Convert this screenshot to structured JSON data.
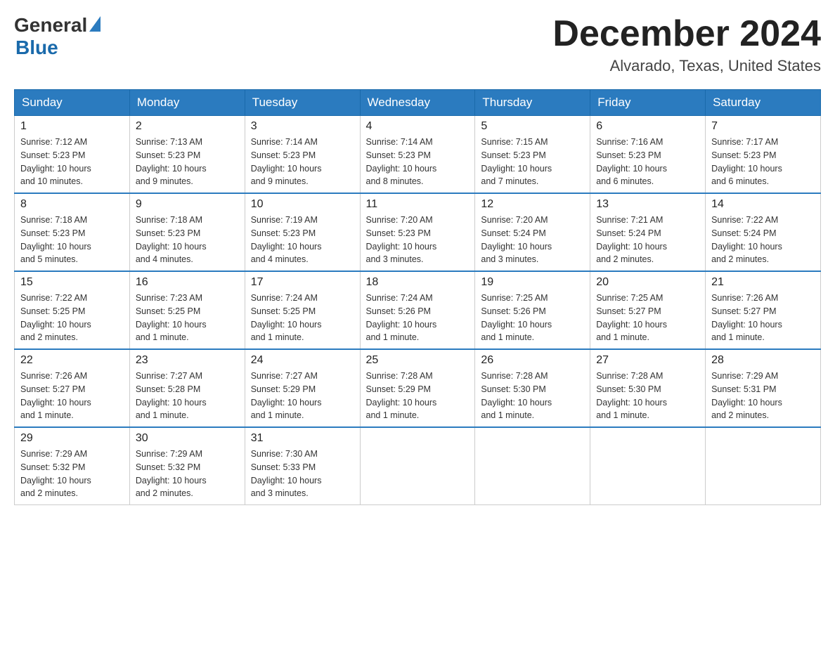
{
  "header": {
    "logo": {
      "general": "General",
      "blue": "Blue"
    },
    "title": "December 2024",
    "location": "Alvarado, Texas, United States"
  },
  "weekdays": [
    "Sunday",
    "Monday",
    "Tuesday",
    "Wednesday",
    "Thursday",
    "Friday",
    "Saturday"
  ],
  "weeks": [
    [
      {
        "day": 1,
        "sunrise": "7:12 AM",
        "sunset": "5:23 PM",
        "daylight": "10 hours and 10 minutes."
      },
      {
        "day": 2,
        "sunrise": "7:13 AM",
        "sunset": "5:23 PM",
        "daylight": "10 hours and 9 minutes."
      },
      {
        "day": 3,
        "sunrise": "7:14 AM",
        "sunset": "5:23 PM",
        "daylight": "10 hours and 9 minutes."
      },
      {
        "day": 4,
        "sunrise": "7:14 AM",
        "sunset": "5:23 PM",
        "daylight": "10 hours and 8 minutes."
      },
      {
        "day": 5,
        "sunrise": "7:15 AM",
        "sunset": "5:23 PM",
        "daylight": "10 hours and 7 minutes."
      },
      {
        "day": 6,
        "sunrise": "7:16 AM",
        "sunset": "5:23 PM",
        "daylight": "10 hours and 6 minutes."
      },
      {
        "day": 7,
        "sunrise": "7:17 AM",
        "sunset": "5:23 PM",
        "daylight": "10 hours and 6 minutes."
      }
    ],
    [
      {
        "day": 8,
        "sunrise": "7:18 AM",
        "sunset": "5:23 PM",
        "daylight": "10 hours and 5 minutes."
      },
      {
        "day": 9,
        "sunrise": "7:18 AM",
        "sunset": "5:23 PM",
        "daylight": "10 hours and 4 minutes."
      },
      {
        "day": 10,
        "sunrise": "7:19 AM",
        "sunset": "5:23 PM",
        "daylight": "10 hours and 4 minutes."
      },
      {
        "day": 11,
        "sunrise": "7:20 AM",
        "sunset": "5:23 PM",
        "daylight": "10 hours and 3 minutes."
      },
      {
        "day": 12,
        "sunrise": "7:20 AM",
        "sunset": "5:24 PM",
        "daylight": "10 hours and 3 minutes."
      },
      {
        "day": 13,
        "sunrise": "7:21 AM",
        "sunset": "5:24 PM",
        "daylight": "10 hours and 2 minutes."
      },
      {
        "day": 14,
        "sunrise": "7:22 AM",
        "sunset": "5:24 PM",
        "daylight": "10 hours and 2 minutes."
      }
    ],
    [
      {
        "day": 15,
        "sunrise": "7:22 AM",
        "sunset": "5:25 PM",
        "daylight": "10 hours and 2 minutes."
      },
      {
        "day": 16,
        "sunrise": "7:23 AM",
        "sunset": "5:25 PM",
        "daylight": "10 hours and 1 minute."
      },
      {
        "day": 17,
        "sunrise": "7:24 AM",
        "sunset": "5:25 PM",
        "daylight": "10 hours and 1 minute."
      },
      {
        "day": 18,
        "sunrise": "7:24 AM",
        "sunset": "5:26 PM",
        "daylight": "10 hours and 1 minute."
      },
      {
        "day": 19,
        "sunrise": "7:25 AM",
        "sunset": "5:26 PM",
        "daylight": "10 hours and 1 minute."
      },
      {
        "day": 20,
        "sunrise": "7:25 AM",
        "sunset": "5:27 PM",
        "daylight": "10 hours and 1 minute."
      },
      {
        "day": 21,
        "sunrise": "7:26 AM",
        "sunset": "5:27 PM",
        "daylight": "10 hours and 1 minute."
      }
    ],
    [
      {
        "day": 22,
        "sunrise": "7:26 AM",
        "sunset": "5:27 PM",
        "daylight": "10 hours and 1 minute."
      },
      {
        "day": 23,
        "sunrise": "7:27 AM",
        "sunset": "5:28 PM",
        "daylight": "10 hours and 1 minute."
      },
      {
        "day": 24,
        "sunrise": "7:27 AM",
        "sunset": "5:29 PM",
        "daylight": "10 hours and 1 minute."
      },
      {
        "day": 25,
        "sunrise": "7:28 AM",
        "sunset": "5:29 PM",
        "daylight": "10 hours and 1 minute."
      },
      {
        "day": 26,
        "sunrise": "7:28 AM",
        "sunset": "5:30 PM",
        "daylight": "10 hours and 1 minute."
      },
      {
        "day": 27,
        "sunrise": "7:28 AM",
        "sunset": "5:30 PM",
        "daylight": "10 hours and 1 minute."
      },
      {
        "day": 28,
        "sunrise": "7:29 AM",
        "sunset": "5:31 PM",
        "daylight": "10 hours and 2 minutes."
      }
    ],
    [
      {
        "day": 29,
        "sunrise": "7:29 AM",
        "sunset": "5:32 PM",
        "daylight": "10 hours and 2 minutes."
      },
      {
        "day": 30,
        "sunrise": "7:29 AM",
        "sunset": "5:32 PM",
        "daylight": "10 hours and 2 minutes."
      },
      {
        "day": 31,
        "sunrise": "7:30 AM",
        "sunset": "5:33 PM",
        "daylight": "10 hours and 3 minutes."
      },
      null,
      null,
      null,
      null
    ]
  ],
  "labels": {
    "sunrise": "Sunrise:",
    "sunset": "Sunset:",
    "daylight": "Daylight:"
  }
}
